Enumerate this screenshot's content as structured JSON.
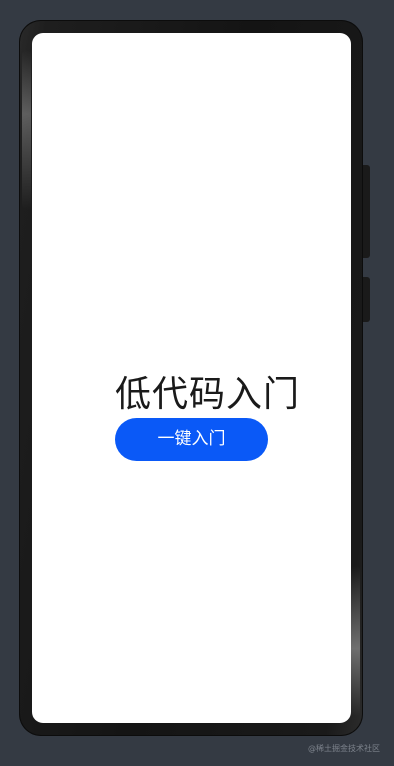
{
  "screen": {
    "title": "低代码入门",
    "start_button_label": "一键入门"
  },
  "watermark": {
    "text": "@稀土掘金技术社区"
  },
  "colors": {
    "background": "#343a43",
    "screen": "#ffffff",
    "primary_button": "#0a59f7",
    "title_text": "#1a1a1a"
  }
}
